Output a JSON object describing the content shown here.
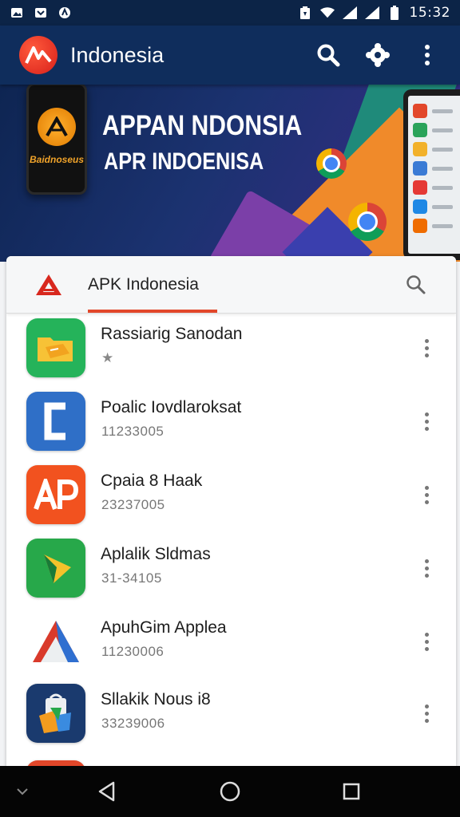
{
  "status_bar": {
    "time": "15:32",
    "left_icons": [
      "photo-icon",
      "gallery-icon",
      "shield-icon"
    ],
    "right_icons": [
      "notification-icon",
      "wifi-icon",
      "signal-icon",
      "signal-icon",
      "battery-icon"
    ]
  },
  "app_bar": {
    "title": "Indonesia",
    "actions": [
      "search-icon",
      "settings-icon",
      "more-vert-icon"
    ]
  },
  "banner": {
    "headline_1": "APPAN NDONSIA",
    "headline_2": "APR INDOENISA",
    "phone_brand": "Baidnoseus"
  },
  "store": {
    "title": "APK Indonesia"
  },
  "apps": [
    {
      "name": "Rassiarig Sanodan",
      "subtitle": "★",
      "icon": "folder-icon",
      "color": "#25b35a"
    },
    {
      "name": "Poalic Iovdlaroksat",
      "subtitle": "11233005",
      "icon": "c-letter-icon",
      "color": "#2f6fc7"
    },
    {
      "name": "Cpaia 8 Haak",
      "subtitle": "23237005",
      "icon": "ap-letters-icon",
      "color": "#f2521f"
    },
    {
      "name": "Aplalik Sldmas",
      "subtitle": "31-34105",
      "icon": "arrow-icon",
      "color": "#27a84a"
    },
    {
      "name": "ApuhGim Applea",
      "subtitle": "11230006",
      "icon": "triangle-logo-icon",
      "color": "#ffffff"
    },
    {
      "name": "Sllakik Nous i8",
      "subtitle": "33239006",
      "icon": "shopping-bag-icon",
      "color": "#1a3a6e"
    }
  ],
  "nav_bar": {
    "buttons": [
      "back-icon",
      "home-icon",
      "recents-icon"
    ]
  }
}
